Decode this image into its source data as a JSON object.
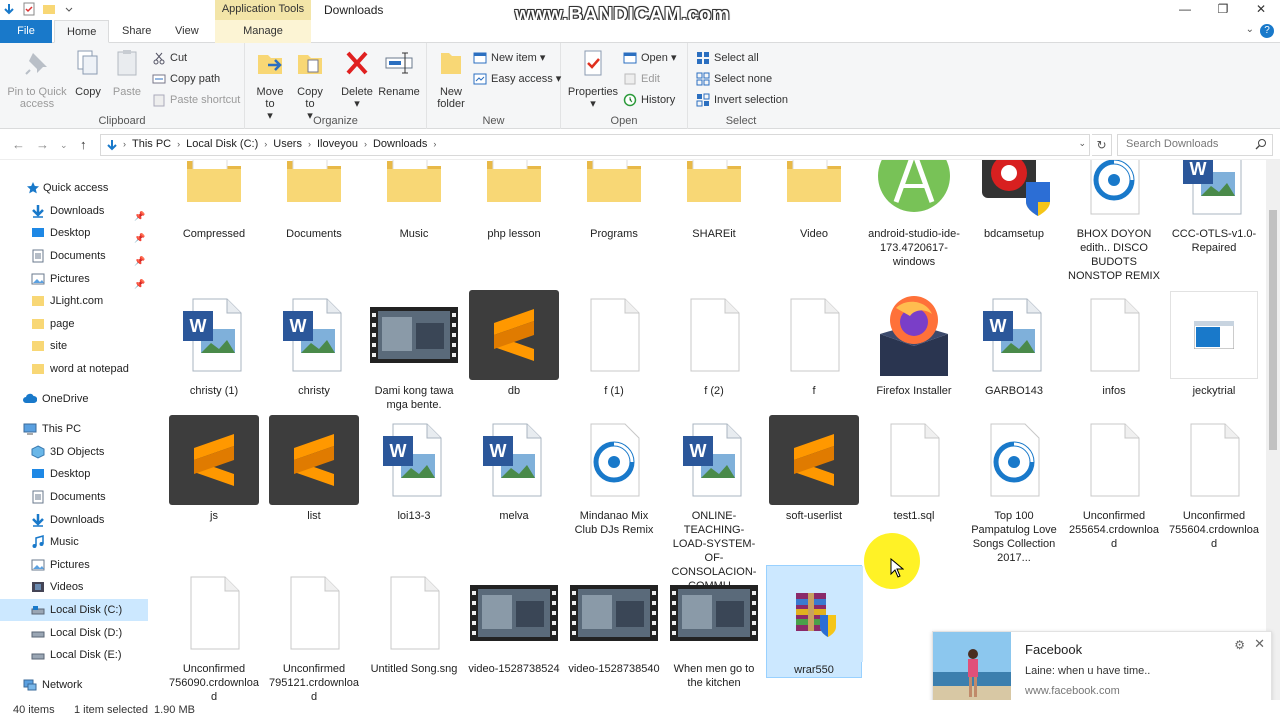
{
  "window": {
    "context_tab": "Application Tools",
    "title": "Downloads",
    "watermark": "www.BANDICAM.com",
    "minimize": "—",
    "maximize": "❐",
    "close": "✕"
  },
  "tabs": {
    "file": "File",
    "home": "Home",
    "share": "Share",
    "view": "View",
    "manage": "Manage"
  },
  "ribbon": {
    "clipboard": {
      "label": "Clipboard",
      "pin": "Pin to Quick access",
      "copy": "Copy",
      "paste": "Paste",
      "cut": "Cut",
      "copy_path": "Copy path",
      "paste_shortcut": "Paste shortcut"
    },
    "organize": {
      "label": "Organize",
      "move_to": "Move to",
      "copy_to": "Copy to",
      "delete": "Delete",
      "rename": "Rename"
    },
    "new": {
      "label": "New",
      "new_folder": "New folder",
      "new_item": "New item",
      "easy_access": "Easy access"
    },
    "open": {
      "label": "Open",
      "properties": "Properties",
      "open": "Open",
      "edit": "Edit",
      "history": "History"
    },
    "select": {
      "label": "Select",
      "select_all": "Select all",
      "select_none": "Select none",
      "invert": "Invert selection"
    }
  },
  "address": {
    "crumbs": [
      "This PC",
      "Local Disk (C:)",
      "Users",
      "Iloveyou",
      "Downloads"
    ],
    "search_placeholder": "Search Downloads"
  },
  "nav": {
    "quick_access": "Quick access",
    "qa_items": [
      "Downloads",
      "Desktop",
      "Documents",
      "Pictures",
      "JLight.com",
      "page",
      "site",
      "word at notepad"
    ],
    "onedrive": "OneDrive",
    "this_pc": "This PC",
    "pc_items": [
      "3D Objects",
      "Desktop",
      "Documents",
      "Downloads",
      "Music",
      "Pictures",
      "Videos",
      "Local Disk (C:)",
      "Local Disk (D:)",
      "Local Disk (E:)"
    ],
    "network": "Network"
  },
  "files": [
    {
      "name": "Compressed",
      "icon": "folder-icon"
    },
    {
      "name": "Documents",
      "icon": "folder-icon"
    },
    {
      "name": "Music",
      "icon": "folder-icon"
    },
    {
      "name": "php lesson",
      "icon": "folder-icon"
    },
    {
      "name": "Programs",
      "icon": "folder-icon"
    },
    {
      "name": "SHAREit",
      "icon": "folder-icon"
    },
    {
      "name": "Video",
      "icon": "folder-icon"
    },
    {
      "name": "android-studio-ide-173.4720617-windows",
      "icon": "android-studio-icon"
    },
    {
      "name": "bdcamsetup",
      "icon": "bandicam-setup-icon"
    },
    {
      "name": "BHOX DOYON edith.. DISCO BUDOTS NONSTOP REMIX",
      "icon": "media-file-icon"
    },
    {
      "name": "CCC-OTLS-v1.0-Repaired",
      "icon": "word-document-icon"
    },
    {
      "name": "christy (1)",
      "icon": "word-document-icon"
    },
    {
      "name": "christy",
      "icon": "word-document-icon"
    },
    {
      "name": "Dami kong tawa mga bente.",
      "icon": "video-thumbnail-icon"
    },
    {
      "name": "db",
      "icon": "sublime-file-icon"
    },
    {
      "name": "f (1)",
      "icon": "blank-file-icon"
    },
    {
      "name": "f (2)",
      "icon": "blank-file-icon"
    },
    {
      "name": "f",
      "icon": "blank-file-icon"
    },
    {
      "name": "Firefox Installer",
      "icon": "firefox-installer-icon"
    },
    {
      "name": "GARBO143",
      "icon": "word-document-icon"
    },
    {
      "name": "infos",
      "icon": "blank-file-icon"
    },
    {
      "name": "jeckytrial",
      "icon": "window-file-icon"
    },
    {
      "name": "js",
      "icon": "sublime-file-icon"
    },
    {
      "name": "list",
      "icon": "sublime-file-icon"
    },
    {
      "name": "loi13-3",
      "icon": "word-document-icon"
    },
    {
      "name": "melva",
      "icon": "word-document-icon"
    },
    {
      "name": "Mindanao Mix Club DJs Remix",
      "icon": "media-file-icon"
    },
    {
      "name": "ONLINE-TEACHING-LOAD-SYSTEM-OF-CONSOLACION-COMMU...",
      "icon": "word-document-icon"
    },
    {
      "name": "soft-userlist",
      "icon": "sublime-file-icon"
    },
    {
      "name": "test1.sql",
      "icon": "blank-file-icon"
    },
    {
      "name": "Top 100 Pampatulog Love Songs Collection 2017...",
      "icon": "media-file-icon"
    },
    {
      "name": "Unconfirmed 255654.crdownload",
      "icon": "blank-file-icon"
    },
    {
      "name": "Unconfirmed 755604.crdownload",
      "icon": "blank-file-icon"
    },
    {
      "name": "Unconfirmed 756090.crdownload",
      "icon": "blank-file-icon"
    },
    {
      "name": "Unconfirmed 795121.crdownload",
      "icon": "blank-file-icon"
    },
    {
      "name": "Untitled Song.sng",
      "icon": "blank-file-icon"
    },
    {
      "name": "video-1528738524",
      "icon": "video-thumbnail-icon"
    },
    {
      "name": "video-1528738540",
      "icon": "video-thumbnail-icon"
    },
    {
      "name": "When men go to the kitchen",
      "icon": "video-thumbnail-icon"
    },
    {
      "name": "wrar550",
      "icon": "winrar-installer-icon"
    }
  ],
  "status": {
    "count": "40 items",
    "selection": "1 item selected",
    "size": "1.90 MB"
  },
  "toast": {
    "title": "Facebook",
    "message": "Laine: when u have time..",
    "source": "www.facebook.com"
  },
  "colors": {
    "accent": "#1979ca",
    "selection": "#cce8ff",
    "folder": "#f8d775",
    "sublime": "#ff9800",
    "word": "#2b579a"
  }
}
